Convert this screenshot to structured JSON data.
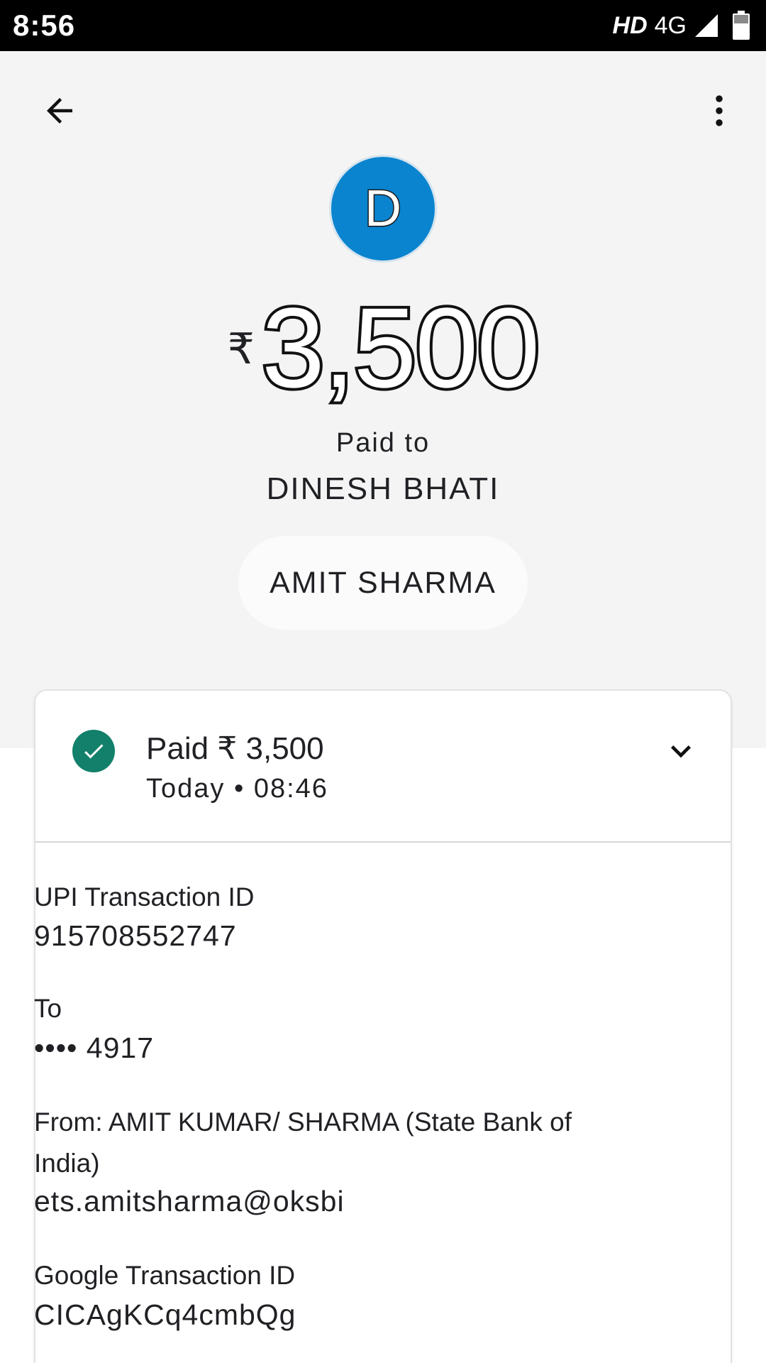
{
  "status_bar": {
    "time": "8:56",
    "hd": "HD",
    "network": "4G",
    "icons": [
      "signal-icon",
      "battery-icon"
    ]
  },
  "header": {
    "back_icon": "arrow-left-icon",
    "menu_icon": "more-vert-icon"
  },
  "payment": {
    "avatar_letter": "D",
    "currency_symbol": "₹",
    "amount": "3,500",
    "paid_to_label": "Paid to",
    "payee_name": "DINESH BHATI",
    "sender_name": "AMIT SHARMA"
  },
  "card": {
    "status_icon": "check-circle-icon",
    "status_text": "Paid ₹ 3,500",
    "time_text": "Today • 08:46",
    "expand_icon": "chevron-down-icon",
    "details": {
      "upi_label": "UPI Transaction ID",
      "upi_id": "915708552747",
      "to_label": "To",
      "to_account": "•••• 4917",
      "from_text": "From: AMIT KUMAR/ SHARMA (State Bank of India)",
      "from_vpa": "ets.amitsharma@oksbi",
      "google_label": "Google Transaction ID",
      "google_id": "CICAgKCq4cmbQg"
    }
  },
  "colors": {
    "avatar_bg": "#0a84cf",
    "success_green": "#12806a",
    "header_bg": "#f4f4f4",
    "status_bar_bg": "#000000"
  }
}
